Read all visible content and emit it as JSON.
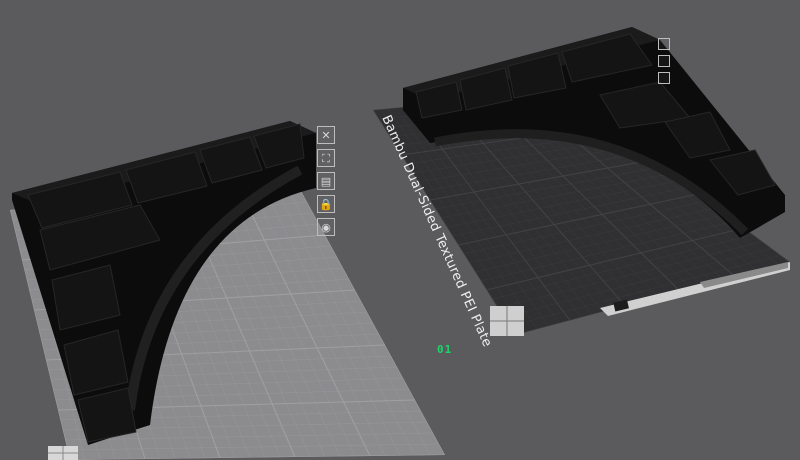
{
  "scene": {
    "plate_1": {
      "number_label": "01",
      "tools": [
        {
          "name": "close-icon",
          "glyph": "✕"
        },
        {
          "name": "auto-orient-icon",
          "glyph": "⛶"
        },
        {
          "name": "plate-settings-icon",
          "glyph": "▤"
        },
        {
          "name": "lock-icon",
          "glyph": "🔒"
        },
        {
          "name": "settings-icon",
          "glyph": "◉"
        }
      ]
    },
    "plate_2": {
      "label": "Bambu Dual-Sided Textured PEI Plate"
    }
  },
  "colors": {
    "background": "#5b5b5e",
    "plate_light": "#8c8c8f",
    "plate_dark": "#303032",
    "grid_light": "#a1a1a4",
    "grid_dark": "#444446",
    "model": "#0d0d0d",
    "model_top": "#1a1a1a",
    "plate_number": "#1fd36b"
  }
}
